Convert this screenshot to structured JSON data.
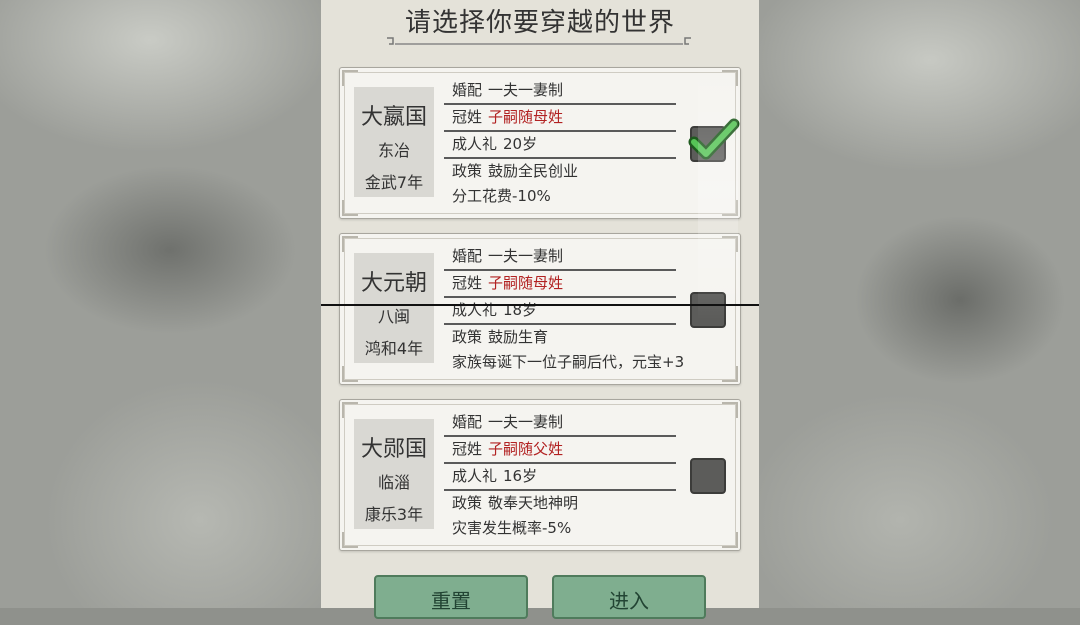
{
  "title": "请选择你要穿越的世界",
  "labels": {
    "marriage": "婚配",
    "surname": "冠姓",
    "coming_of_age": "成人礼",
    "policy": "政策"
  },
  "worlds": [
    {
      "name": "大嬴国",
      "place": "东冶",
      "era": "金武7年",
      "marriage": "一夫一妻制",
      "surname": "子嗣随母姓",
      "coming_of_age": "20岁",
      "policy": "鼓励全民创业",
      "effect": "分工花费-10%",
      "selected": true
    },
    {
      "name": "大元朝",
      "place": "八闽",
      "era": "鸿和4年",
      "marriage": "一夫一妻制",
      "surname": "子嗣随母姓",
      "coming_of_age": "18岁",
      "policy": "鼓励生育",
      "effect": "家族每诞下一位子嗣后代，元宝+3",
      "selected": false
    },
    {
      "name": "大郧国",
      "place": "临淄",
      "era": "康乐3年",
      "marriage": "一夫一妻制",
      "surname": "子嗣随父姓",
      "coming_of_age": "16岁",
      "policy": "敬奉天地神明",
      "effect": "灾害发生概率-5%",
      "selected": false
    }
  ],
  "buttons": {
    "reset": "重置",
    "enter": "进入"
  },
  "colors": {
    "panel": "#e4e2d9",
    "accent_red": "#b22222",
    "button_green": "#7fae8f",
    "check_green": "#4caf50"
  }
}
